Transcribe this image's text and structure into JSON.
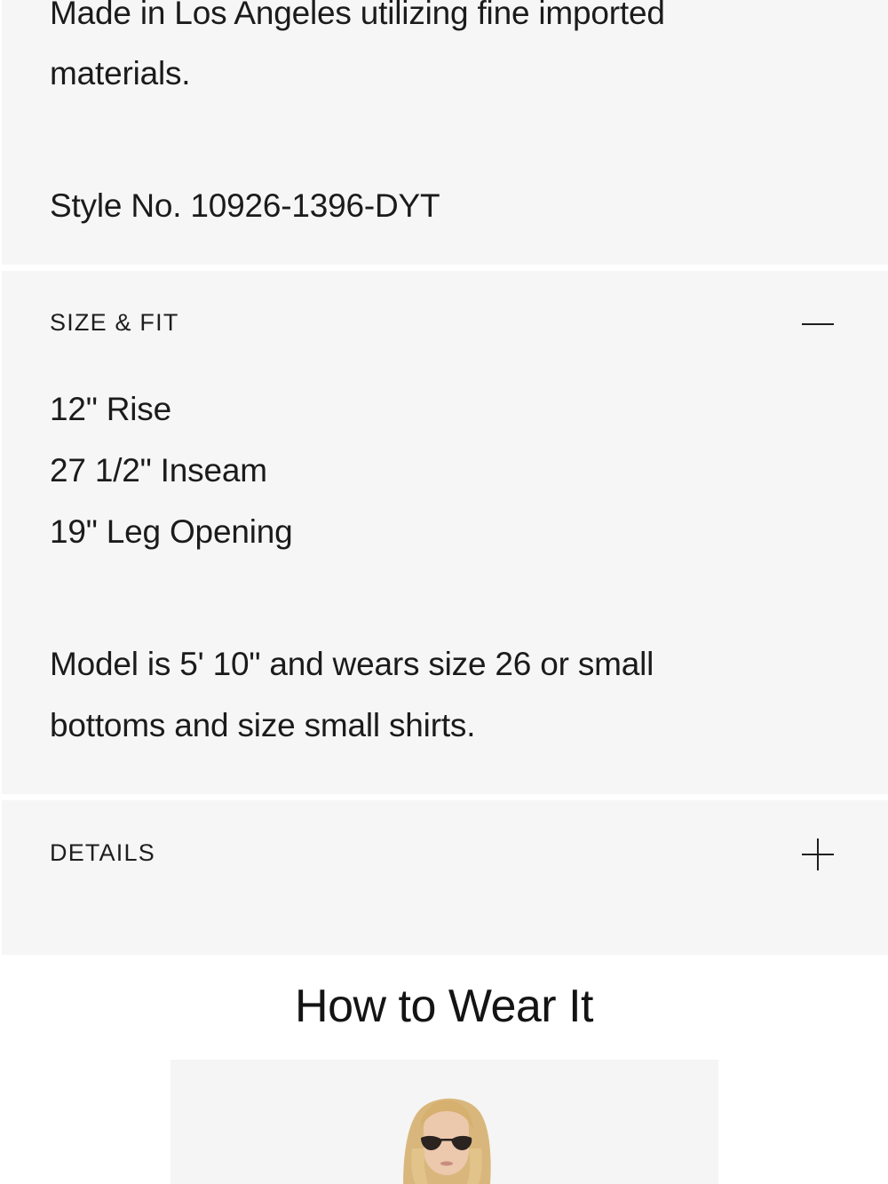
{
  "description": {
    "line1": "Made in Los Angeles utilizing fine imported",
    "line2": "materials.",
    "style_number": "Style No. 10926-1396-DYT"
  },
  "size_fit": {
    "heading": "SIZE & FIT",
    "toggle_icon": "minus-icon",
    "measurements": [
      "12\" Rise",
      "27 1/2\" Inseam",
      "19\" Leg Opening"
    ],
    "model_line1": "Model is 5' 10\" and wears size 26 or small",
    "model_line2": "bottoms and size small shirts."
  },
  "details": {
    "heading": "DETAILS",
    "toggle_icon": "plus-icon"
  },
  "how_to_wear": {
    "title": "How to Wear It"
  }
}
